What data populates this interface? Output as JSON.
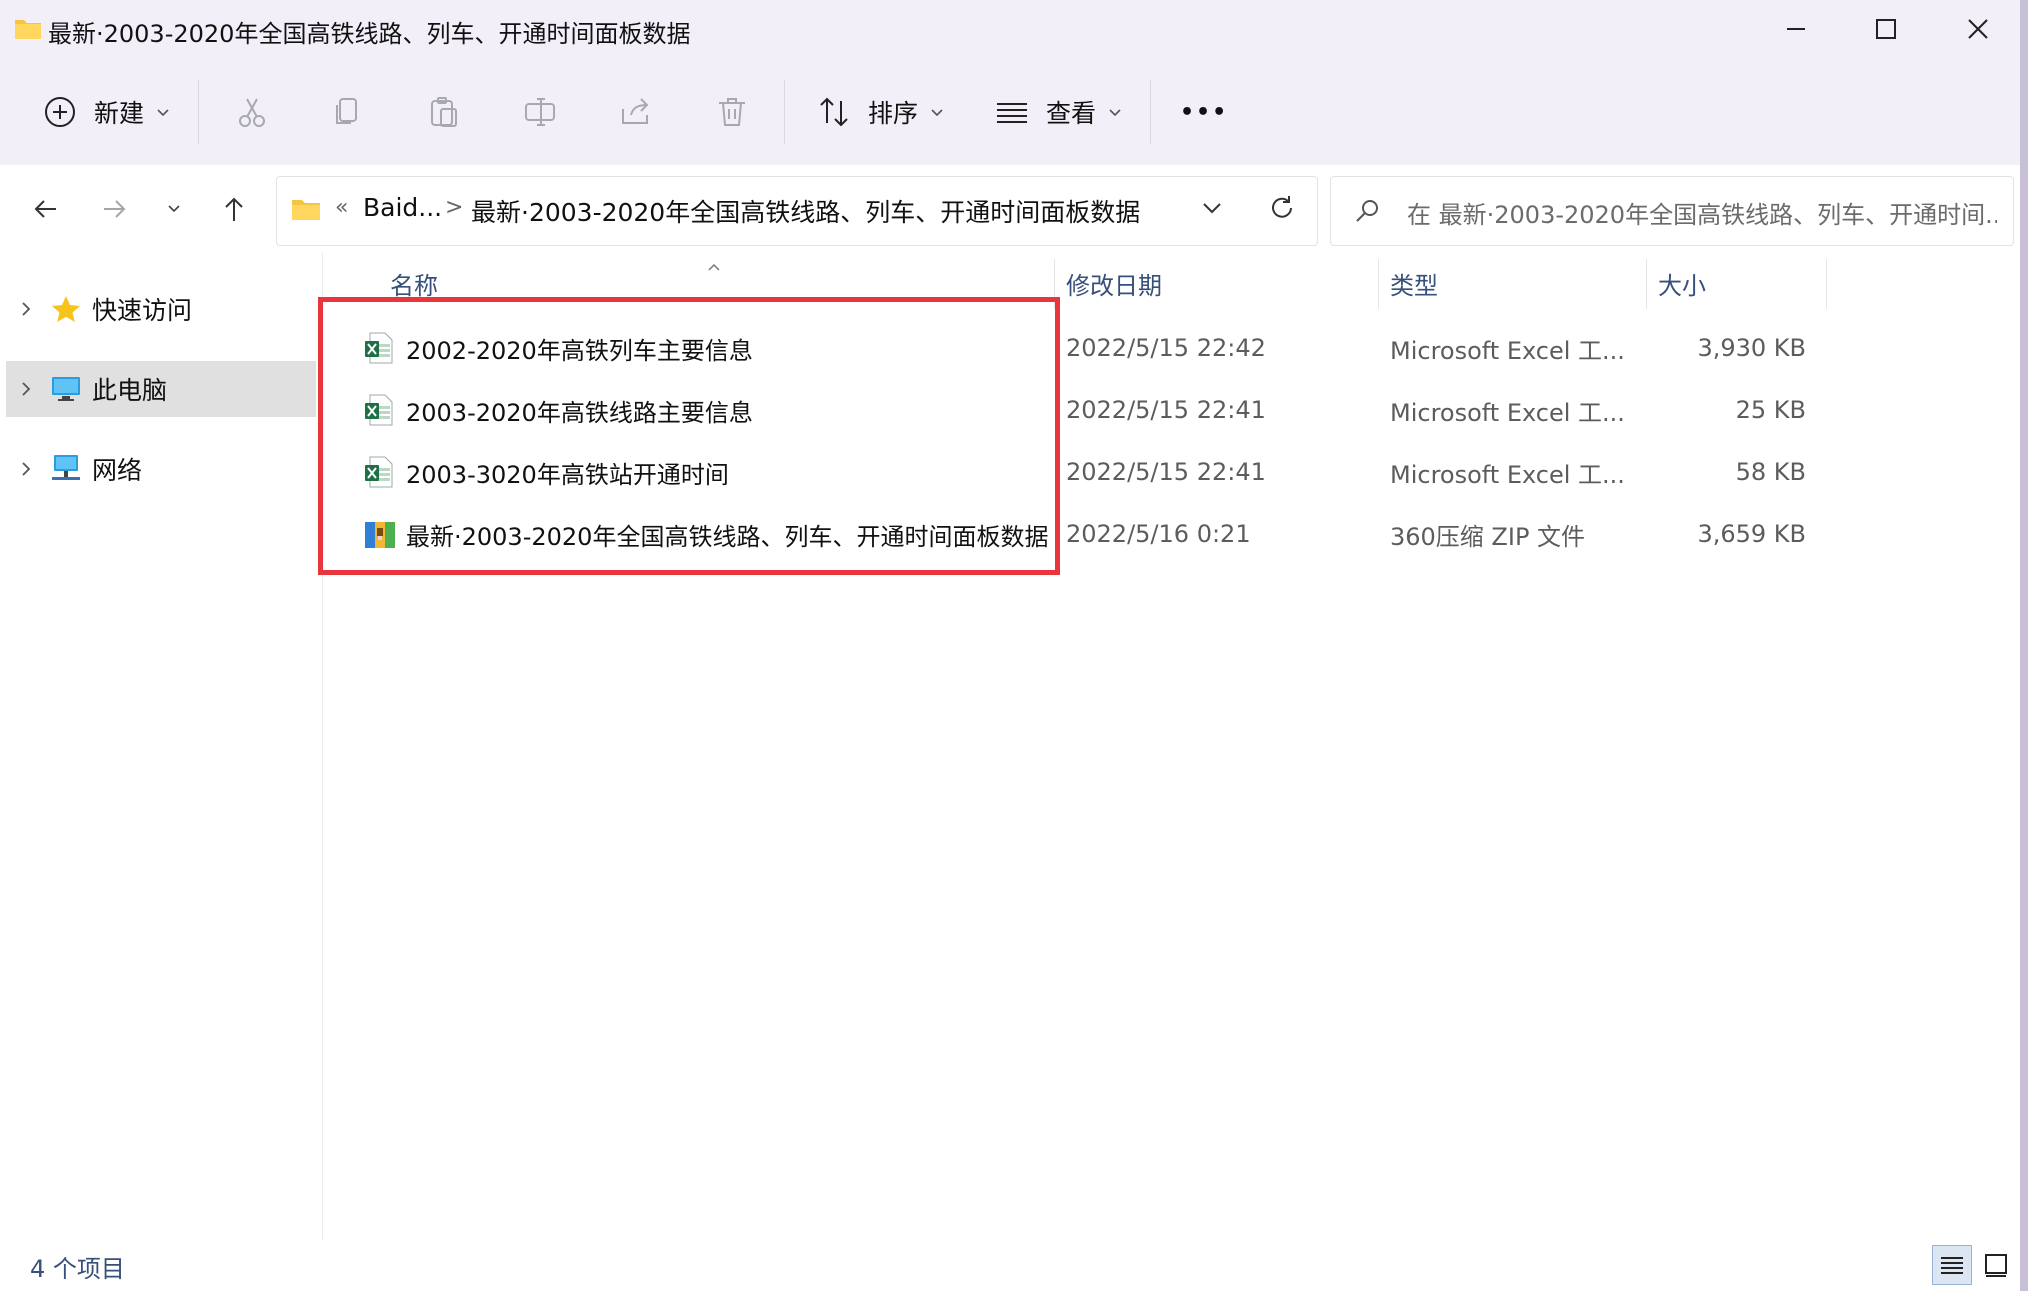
{
  "window": {
    "title": "最新·2003-2020年全国高铁线路、列车、开通时间面板数据"
  },
  "toolbar": {
    "new_label": "新建",
    "sort_label": "排序",
    "view_label": "查看",
    "more_label": "•••"
  },
  "address": {
    "overflow": "«",
    "segment1": "Baid...",
    "separator": ">",
    "segment2": "最新·2003-2020年全国高铁线路、列车、开通时间面板数据"
  },
  "search": {
    "placeholder": "在 最新·2003-2020年全国高铁线路、列车、开通时间..."
  },
  "sidebar": {
    "items": [
      {
        "label": "快速访问",
        "icon": "star-icon"
      },
      {
        "label": "此电脑",
        "icon": "computer-icon"
      },
      {
        "label": "网络",
        "icon": "network-icon"
      }
    ]
  },
  "columns": {
    "name": "名称",
    "modified": "修改日期",
    "type": "类型",
    "size": "大小"
  },
  "files": [
    {
      "name": "2002-2020年高铁列车主要信息",
      "modified": "2022/5/15 22:42",
      "type": "Microsoft Excel 工...",
      "size": "3,930 KB",
      "icon": "excel-file-icon"
    },
    {
      "name": "2003-2020年高铁线路主要信息",
      "modified": "2022/5/15 22:41",
      "type": "Microsoft Excel 工...",
      "size": "25 KB",
      "icon": "excel-file-icon"
    },
    {
      "name": "2003-3020年高铁站开通时间",
      "modified": "2022/5/15 22:41",
      "type": "Microsoft Excel 工...",
      "size": "58 KB",
      "icon": "excel-file-icon"
    },
    {
      "name": "最新·2003-2020年全国高铁线路、列车、开通时间面板数据",
      "modified": "2022/5/16 0:21",
      "type": "360压缩 ZIP 文件",
      "size": "3,659 KB",
      "icon": "zip-archive-icon"
    }
  ],
  "status": {
    "item_count": "4 个项目"
  },
  "colors": {
    "highlight": "#e9363c",
    "toolbar_bg": "#f2eff8",
    "column_header": "#37507a"
  }
}
